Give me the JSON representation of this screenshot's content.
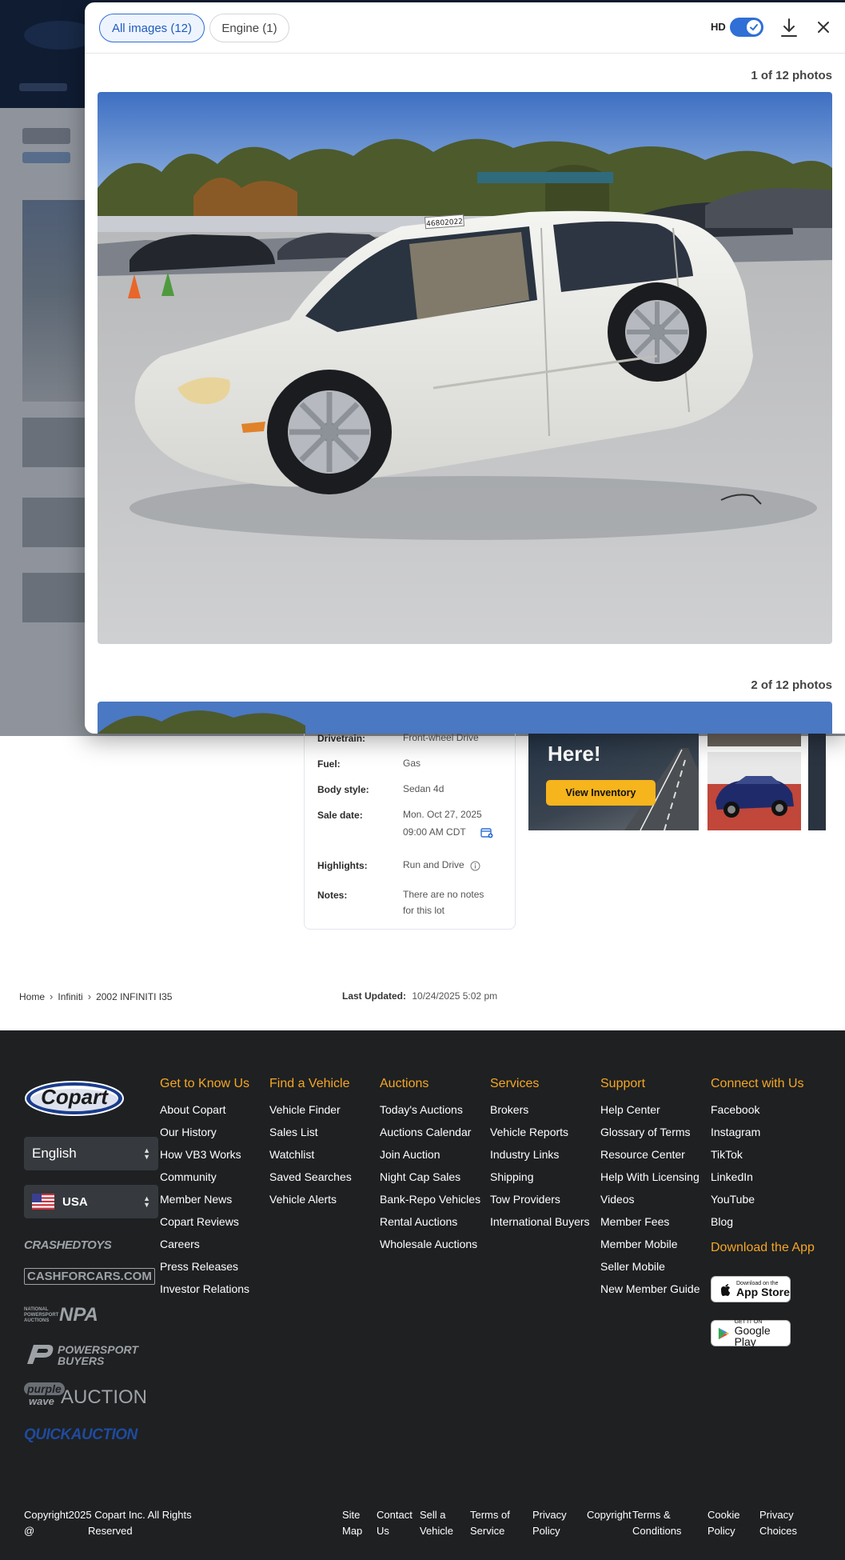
{
  "modal": {
    "tabs": [
      {
        "label": "All images (12)",
        "selected": true
      },
      {
        "label": "Engine (1)",
        "selected": false
      }
    ],
    "hd_label": "HD",
    "hd_enabled": true,
    "photo_counters": [
      "1 of 12 photos",
      "2 of 12 photos"
    ],
    "lot_tag": "46802022"
  },
  "details": {
    "rows": [
      {
        "label": "Drivetrain:",
        "value": "Front-wheel Drive"
      },
      {
        "label": "Fuel:",
        "value": "Gas"
      },
      {
        "label": "Body style:",
        "value": "Sedan 4d"
      },
      {
        "label": "Sale date:",
        "value": "Mon. Oct 27, 2025",
        "value2": "09:00 AM CDT"
      },
      {
        "label": "Highlights:",
        "value": "Run and Drive"
      },
      {
        "label": "Notes:",
        "value": "There are no notes",
        "value2": "for this lot"
      }
    ]
  },
  "promo": {
    "title": "Here!",
    "button": "View Inventory"
  },
  "breadcrumb": [
    "Home",
    "Infiniti",
    "2002 INFINITI I35"
  ],
  "last_updated": {
    "label": "Last Updated:",
    "value": "10/24/2025 5:02 pm"
  },
  "footer": {
    "logo_text": "Copart",
    "language": "English",
    "country": "USA",
    "brands": [
      "CRASHEDTOYS",
      "CASHFORCARS.COM",
      "NATIONAL POWERSPORT AUCTIONS",
      "NPA",
      "POWERSPORT",
      "BUYERS",
      "purple",
      "wave",
      "AUCTION",
      "QUICKAUCTION"
    ],
    "columns": [
      {
        "heading": "Get to Know Us",
        "items": [
          "About Copart",
          "Our History",
          "How VB3 Works",
          "Community",
          "Member News",
          "Copart Reviews",
          "Careers",
          "Press Releases",
          "Investor Relations"
        ]
      },
      {
        "heading": "Find a Vehicle",
        "items": [
          "Vehicle Finder",
          "Sales List",
          "Watchlist",
          "Saved Searches",
          "Vehicle Alerts"
        ]
      },
      {
        "heading": "Auctions",
        "items": [
          "Today's Auctions",
          "Auctions Calendar",
          "Join Auction",
          "Night Cap Sales",
          "Bank-Repo Vehicles",
          "Rental Auctions",
          "Wholesale Auctions"
        ]
      },
      {
        "heading": "Services",
        "items": [
          "Brokers",
          "Vehicle Reports",
          "Industry Links",
          "Shipping",
          "Tow Providers",
          "International Buyers"
        ]
      },
      {
        "heading": "Support",
        "items": [
          "Help Center",
          "Glossary of Terms",
          "Resource Center",
          "Help With Licensing",
          "Videos",
          "Member Fees",
          "Member Mobile",
          "Seller Mobile",
          "New Member Guide"
        ]
      },
      {
        "heading": "Connect with Us",
        "items": [
          "Facebook",
          "Instagram",
          "TikTok",
          "LinkedIn",
          "YouTube",
          "Blog"
        ]
      }
    ],
    "download_heading": "Download the App",
    "app_store": {
      "small": "Download on the",
      "big": "App Store"
    },
    "google_play": {
      "small": "GET IT ON",
      "big": "Google Play"
    },
    "copyright": {
      "line1": "Copyright",
      "year": "2025",
      "company": "Copart Inc. All Rights",
      "at": "@",
      "reserved": "Reserved"
    },
    "bottom_links": [
      {
        "l1": "Site",
        "l2": "Map"
      },
      {
        "l1": "Contact",
        "l2": "Us"
      },
      {
        "l1": "Sell a",
        "l2": "Vehicle"
      },
      {
        "l1": "Terms of",
        "l2": "Service"
      },
      {
        "l1": "Privacy",
        "l2": "Policy"
      },
      {
        "l1": "Copyright",
        "l2": ""
      },
      {
        "l1": "Terms &",
        "l2": "Conditions"
      },
      {
        "l1": "Cookie",
        "l2": "Policy"
      },
      {
        "l1": "Privacy",
        "l2": "Choices"
      }
    ]
  },
  "colors": {
    "accent": "#2f6fd6",
    "footer_heading": "#f5a623",
    "footer_bg": "#1e2022",
    "promo_button": "#f6b41d"
  }
}
